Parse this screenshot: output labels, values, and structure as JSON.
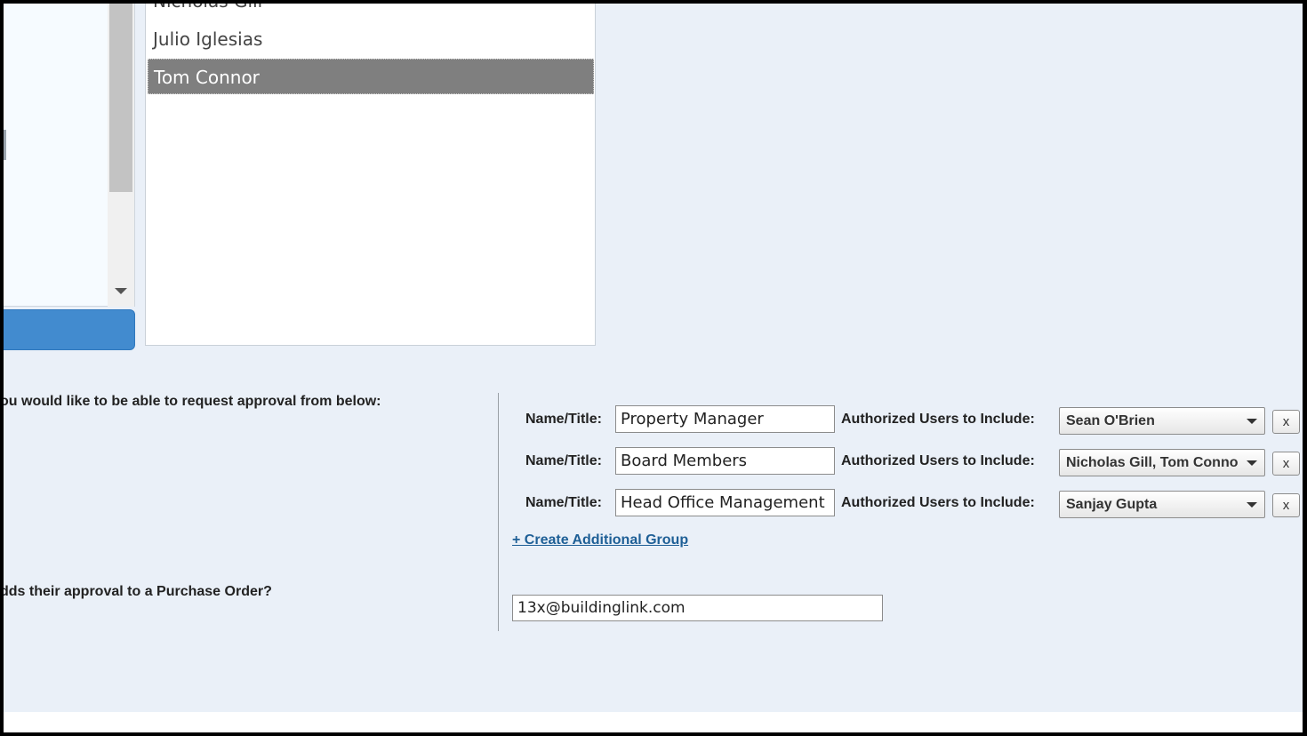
{
  "user_list": {
    "items": [
      "Nicholas Gill",
      "Julio Iglesias",
      "Tom Connor"
    ],
    "selected": "Tom Connor"
  },
  "approval_question": "ou would like to be able to request approval from below:",
  "groups": [
    {
      "name_label": "Name/Title:",
      "name_value": "Property Manager",
      "users_label": "Authorized Users to Include:",
      "users_value": "Sean O'Brien",
      "remove_label": "x"
    },
    {
      "name_label": "Name/Title:",
      "name_value": "Board Members",
      "users_label": "Authorized Users to Include:",
      "users_value": "Nicholas Gill, Tom Connor",
      "remove_label": "x"
    },
    {
      "name_label": "Name/Title:",
      "name_value": "Head Office Management",
      "users_label": "Authorized Users to Include:",
      "users_value": "Sanjay Gupta",
      "remove_label": "x"
    }
  ],
  "create_group_link": "+ Create Additional Group",
  "notify_question": "dds their approval to a Purchase Order?",
  "notify_email": "13x@buildinglink.com",
  "colors": {
    "panel_bg": "#eaf0f8",
    "selected_row": "#7f7f7f",
    "button_blue": "#428bcf",
    "link": "#1e5f96"
  }
}
